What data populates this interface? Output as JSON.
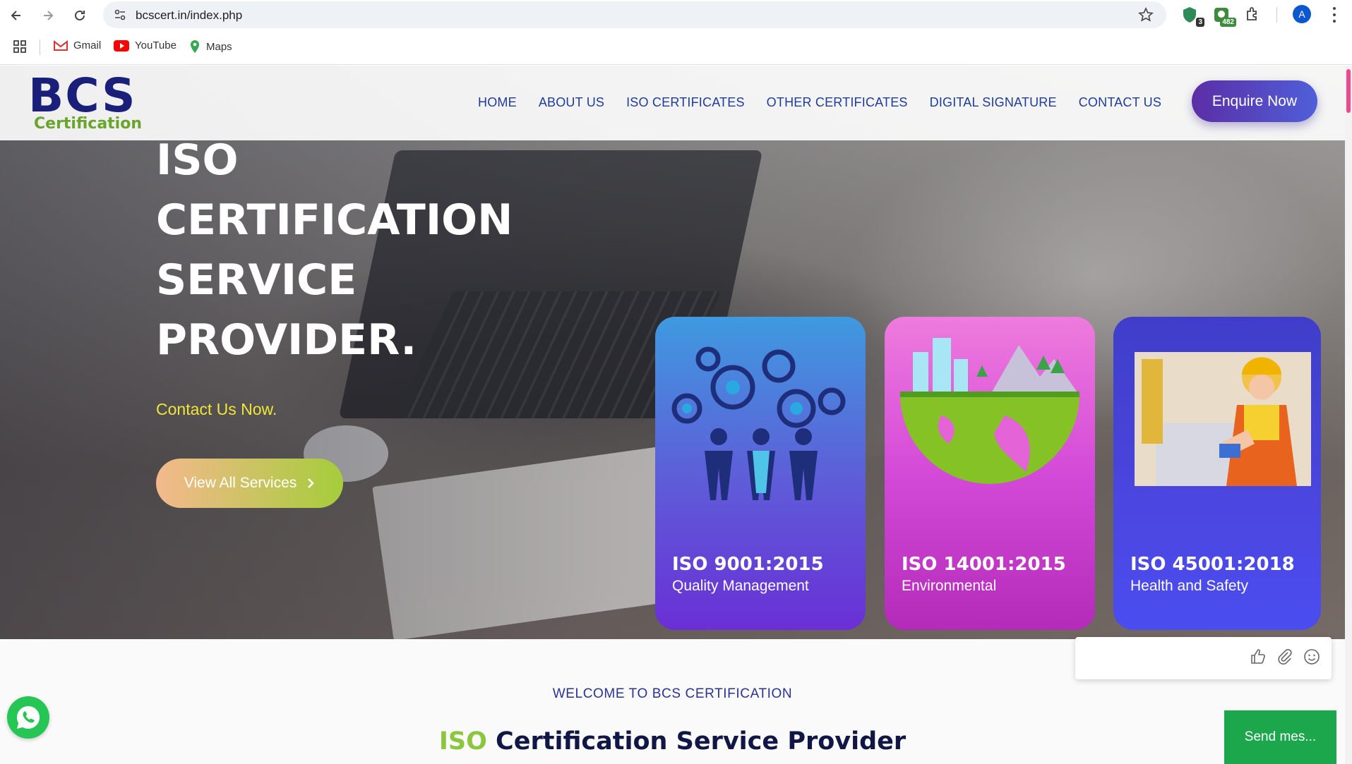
{
  "browser": {
    "url": "bcscert.in/index.php",
    "extensions": [
      {
        "name": "shield-extension",
        "badge": "3"
      },
      {
        "name": "counter-extension",
        "badge": "482"
      }
    ],
    "profile_initial": "A",
    "bookmarks": [
      {
        "label": "Gmail",
        "icon": "gmail-icon"
      },
      {
        "label": "YouTube",
        "icon": "youtube-icon"
      },
      {
        "label": "Maps",
        "icon": "maps-icon"
      }
    ]
  },
  "site": {
    "logo": {
      "main": "BCS",
      "sub": "Certification"
    },
    "nav": [
      "HOME",
      "ABOUT US",
      "ISO CERTIFICATES",
      "OTHER CERTIFICATES",
      "DIGITAL SIGNATURE",
      "CONTACT US"
    ],
    "enquire_label": "Enquire Now",
    "hero": {
      "title_lines": [
        "ISO",
        "CERTIFICATION",
        "SERVICE",
        "PROVIDER."
      ],
      "contact_text": "Contact Us Now.",
      "cta_label": "View All Services"
    },
    "cards": [
      {
        "title": "ISO 9001:2015",
        "subtitle": "Quality Management"
      },
      {
        "title": "ISO 14001:2015",
        "subtitle": "Environmental"
      },
      {
        "title": "ISO 45001:2018",
        "subtitle": "Health and Safety"
      }
    ],
    "welcome": "WELCOME TO BCS CERTIFICATION",
    "heading": {
      "highlight": "ISO",
      "rest": "Certification Service Provider"
    },
    "chat": {
      "send_label": "Send mes..."
    }
  },
  "colors": {
    "brand_navy": "#1a1f7a",
    "brand_green": "#8cc63f",
    "nav_blue": "#1e3c9b",
    "send_green": "#1da74d"
  }
}
